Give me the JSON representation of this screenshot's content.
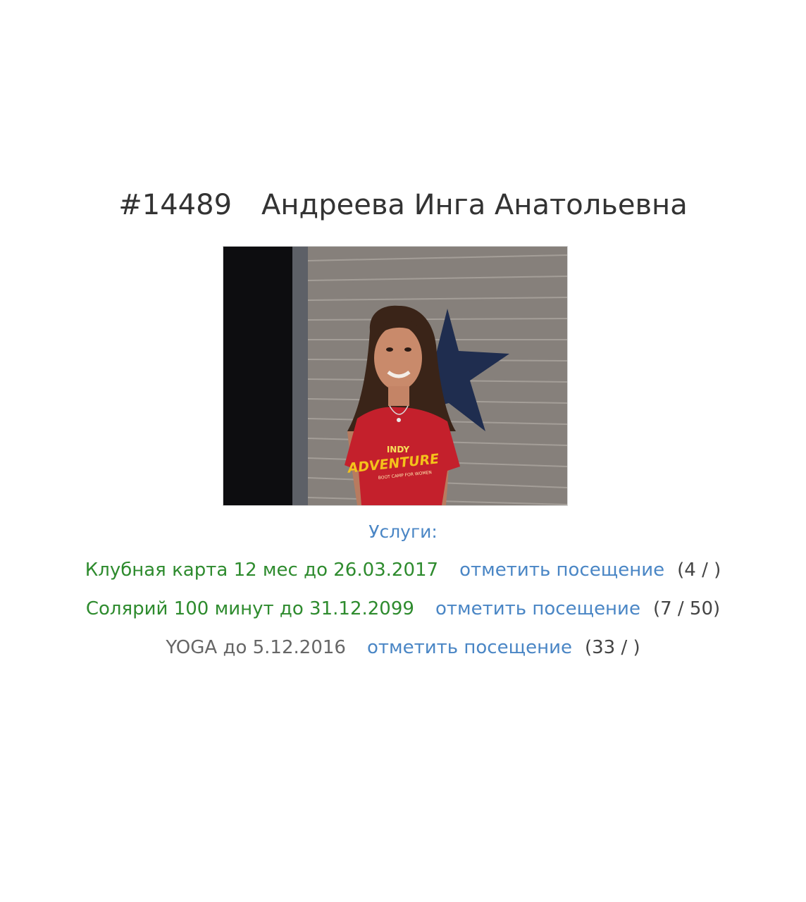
{
  "client": {
    "id": "#14489",
    "name": "Андреева Инга Анатольевна"
  },
  "photo": {
    "shirt_line1": "INDY",
    "shirt_line2": "ADVENTURE",
    "shirt_line3": "BOOT CAMP FOR WOMEN"
  },
  "services": {
    "label": "Услуги:",
    "items": [
      {
        "name": "Клубная карта 12 мес до 26.03.2017",
        "action": "отметить посещение",
        "count": "(4 / )"
      },
      {
        "name": "Солярий 100 минут до 31.12.2099",
        "action": "отметить посещение",
        "count": "(7 / 50)"
      },
      {
        "name": "YOGA до 5.12.2016",
        "action": "отметить посещение",
        "count": "(33 / )"
      }
    ]
  },
  "colors": {
    "active_service": "#2e8b2e",
    "inactive_service": "#666666",
    "link": "#4a86c5"
  }
}
